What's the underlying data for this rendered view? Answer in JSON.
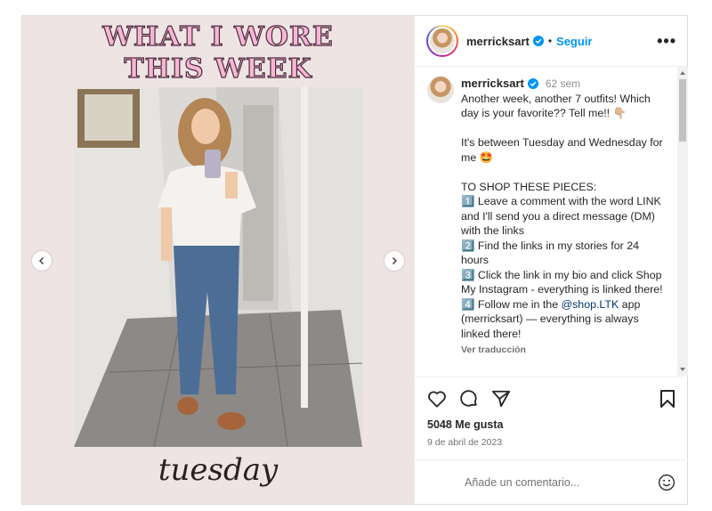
{
  "media": {
    "headline_line1": "WHAT I WORE",
    "headline_line2": "THIS WEEK",
    "day_script": "tuesday",
    "prev_icon": "chevron-left-icon",
    "next_icon": "chevron-right-icon"
  },
  "header": {
    "username": "merricksart",
    "separator": "•",
    "follow_label": "Seguir",
    "more_label": "•••"
  },
  "caption": {
    "username": "merricksart",
    "time": "62 sem",
    "lines": [
      "Another week, another 7 outfits! Which day is your favorite?? Tell me!! 👇🏼",
      "",
      "It's between Tuesday and Wednesday for me 🤩",
      "",
      "TO SHOP THESE PIECES:",
      "1️⃣ Leave a comment with the word LINK and I'll send you a direct message (DM) with the links",
      "2️⃣ Find the links in my stories for 24 hours",
      "3️⃣ Click the link in my bio and click Shop My Instagram - everything is linked there!"
    ],
    "line_last_prefix": "4️⃣ Follow me in the ",
    "mention": "@shop.LTK",
    "line_last_suffix": " app (merricksart) — everything is always linked there!",
    "translate_label": "Ver traducción"
  },
  "actions": {
    "likes": "5048 Me gusta",
    "date": "9 de abril de 2023"
  },
  "comment_box": {
    "placeholder": "Añade un comentario..."
  },
  "colors": {
    "accent": "#0095f6",
    "verified": "#0095f6",
    "background_media": "#efe4e4",
    "headline_fill": "#f7b6d6"
  }
}
